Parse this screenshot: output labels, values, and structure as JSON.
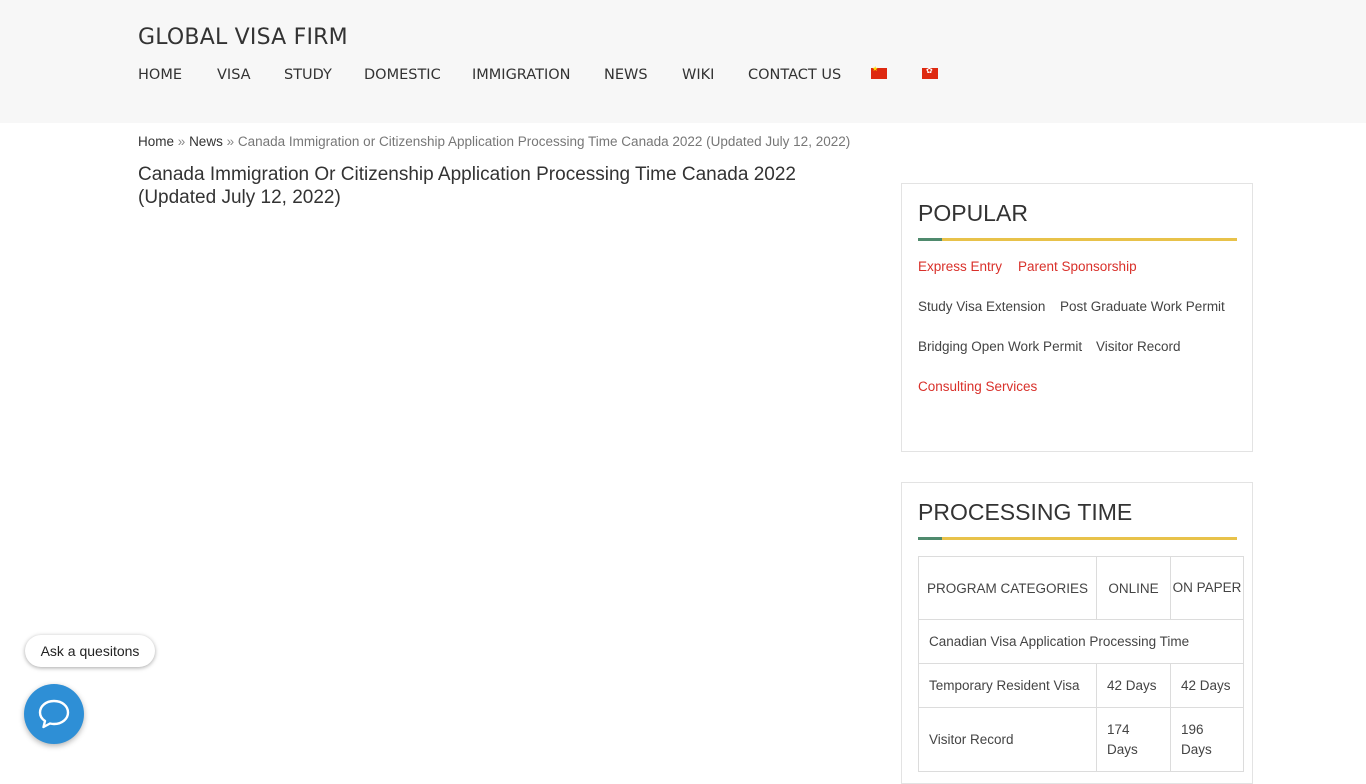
{
  "header": {
    "site_title": "GLOBAL VISA FIRM",
    "nav": [
      "HOME",
      "VISA",
      "STUDY",
      "DOMESTIC",
      "IMMIGRATION",
      "NEWS",
      "WIKI",
      "CONTACT US"
    ],
    "flags": [
      "cn-flag-icon",
      "hk-flag-icon"
    ]
  },
  "breadcrumb": {
    "home": "Home",
    "sep": "»",
    "news": "News",
    "current": "Canada Immigration or Citizenship Application Processing Time Canada 2022 (Updated July 12, 2022)"
  },
  "article": {
    "title": "Canada Immigration Or Citizenship Application Processing Time Canada 2022 (Updated July 12, 2022)"
  },
  "popular": {
    "title": "POPULAR",
    "tags": [
      "Express Entry",
      "Parent Sponsorship",
      "Study Visa Extension",
      "Post Graduate Work Permit",
      "Bridging Open Work Permit",
      "Visitor Record",
      "Consulting Services"
    ]
  },
  "processing": {
    "title": "PROCESSING TIME",
    "headers": [
      "PROGRAM CATEGORIES",
      "ONLINE",
      "ON PAPER"
    ],
    "section": "Canadian Visa Application Processing Time",
    "rows": [
      {
        "name": "Temporary Resident Visa",
        "online": "42 Days",
        "paper": "42 Days"
      },
      {
        "name": "Visitor Record",
        "online": "174 Days",
        "paper": "196 Days"
      }
    ]
  },
  "chat": {
    "ask_label": "Ask a quesitons",
    "icon": "chat-bubble-icon"
  },
  "colors": {
    "accent_red": "#d9302a",
    "underline_yellow": "#e8c24a",
    "underline_green": "#4f8a6d",
    "chat_blue": "#2e8fd6"
  }
}
